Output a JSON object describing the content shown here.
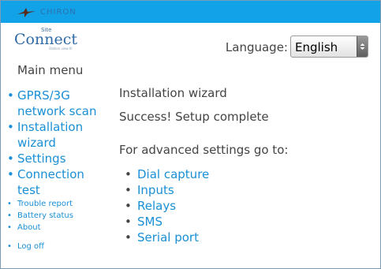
{
  "brand": {
    "name": "CHIRON"
  },
  "logo": {
    "prefix": "Site",
    "name": "Connect",
    "tagline": "Station view III"
  },
  "language": {
    "label": "Language:",
    "selected": "English"
  },
  "sidebar": {
    "title": "Main menu",
    "items": [
      {
        "label": "GPRS/3G network scan"
      },
      {
        "label": "Installation wizard"
      },
      {
        "label": "Settings"
      },
      {
        "label": "Connection test"
      },
      {
        "label": "Trouble report"
      },
      {
        "label": "Battery status"
      },
      {
        "label": "About"
      },
      {
        "label": "Log off"
      }
    ]
  },
  "main": {
    "title": "Installation wizard",
    "status": "Success! Setup complete",
    "advanced_text": "For advanced settings go to:",
    "links": [
      {
        "label": "Dial capture"
      },
      {
        "label": "Inputs"
      },
      {
        "label": "Relays"
      },
      {
        "label": "SMS"
      },
      {
        "label": "Serial port"
      }
    ]
  },
  "colors": {
    "topbar": "#12a2e8",
    "link": "#1a8fd6",
    "text": "#444444",
    "logo": "#2f6aa6"
  },
  "icons": {
    "brand": "bird-icon",
    "dropdown": "chevron-down-icon"
  }
}
